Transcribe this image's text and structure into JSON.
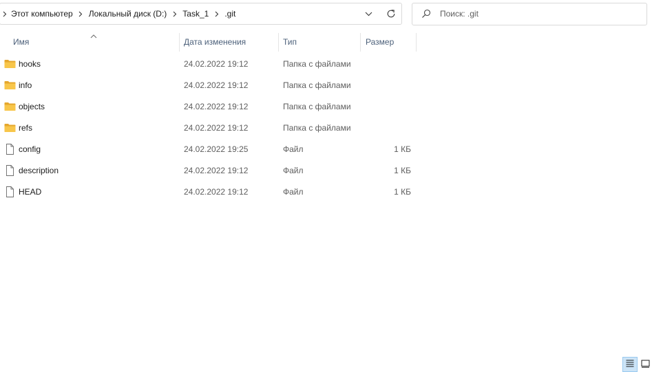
{
  "address_bar": {
    "breadcrumbs": [
      "Этот компьютер",
      "Локальный диск (D:)",
      "Task_1",
      ".git"
    ],
    "icons": {
      "separator": "chevron-right",
      "dropdown": "chevron-down",
      "refresh": "refresh"
    }
  },
  "search": {
    "placeholder": "Поиск: .git",
    "value": "",
    "icon": "search"
  },
  "columns": {
    "name": "Имя",
    "date": "Дата изменения",
    "type": "Тип",
    "size": "Размер",
    "sort": "ascending"
  },
  "files": [
    {
      "name": "hooks",
      "date": "24.02.2022 19:12",
      "type": "Папка с файлами",
      "size": "",
      "icon": "folder"
    },
    {
      "name": "info",
      "date": "24.02.2022 19:12",
      "type": "Папка с файлами",
      "size": "",
      "icon": "folder"
    },
    {
      "name": "objects",
      "date": "24.02.2022 19:12",
      "type": "Папка с файлами",
      "size": "",
      "icon": "folder"
    },
    {
      "name": "refs",
      "date": "24.02.2022 19:12",
      "type": "Папка с файлами",
      "size": "",
      "icon": "folder"
    },
    {
      "name": "config",
      "date": "24.02.2022 19:25",
      "type": "Файл",
      "size": "1 КБ",
      "icon": "file"
    },
    {
      "name": "description",
      "date": "24.02.2022 19:12",
      "type": "Файл",
      "size": "1 КБ",
      "icon": "file"
    },
    {
      "name": "HEAD",
      "date": "24.02.2022 19:12",
      "type": "Файл",
      "size": "1 КБ",
      "icon": "file"
    }
  ],
  "view_modes": {
    "active": "details",
    "icons": [
      "details-view",
      "tiles-view"
    ]
  },
  "colors": {
    "folder": "#f8c64a",
    "header_text": "#4c607a",
    "active_view": "#cce4f7"
  }
}
